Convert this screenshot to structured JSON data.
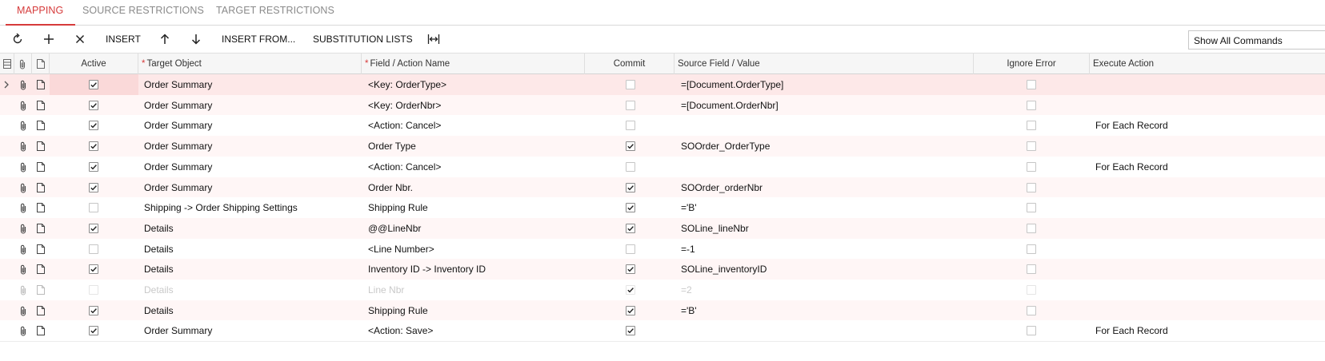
{
  "tabs": [
    {
      "label": "MAPPING",
      "active": true
    },
    {
      "label": "SOURCE RESTRICTIONS",
      "active": false
    },
    {
      "label": "TARGET RESTRICTIONS",
      "active": false
    }
  ],
  "toolbar": {
    "refresh_icon": "refresh-icon",
    "add_icon": "plus-icon",
    "delete_icon": "close-icon",
    "insert_label": "INSERT",
    "move_up_icon": "arrow-up-icon",
    "move_down_icon": "arrow-down-icon",
    "insert_from_label": "INSERT FROM...",
    "substitution_lists_label": "SUBSTITUTION LISTS",
    "fit_columns_icon": "fit-width-icon",
    "commands_value": "Show All Commands"
  },
  "columns": {
    "active": "Active",
    "target_object": "Target Object",
    "field_action": "Field / Action Name",
    "commit": "Commit",
    "source_field": "Source Field / Value",
    "ignore_error": "Ignore Error",
    "execute_action": "Execute Action"
  },
  "colors": {
    "accent": "#d63b3b"
  },
  "rows": [
    {
      "active": true,
      "target": "Order Summary",
      "field": "<Key: OrderType>",
      "commit": false,
      "source": "=[Document.OrderType]",
      "ignore": false,
      "execute": "",
      "selected": true
    },
    {
      "active": true,
      "target": "Order Summary",
      "field": "<Key: OrderNbr>",
      "commit": false,
      "source": "=[Document.OrderNbr]",
      "ignore": false,
      "execute": ""
    },
    {
      "active": true,
      "target": "Order Summary",
      "field": "<Action: Cancel>",
      "commit": false,
      "source": "",
      "ignore": false,
      "execute": "For Each Record"
    },
    {
      "active": true,
      "target": "Order Summary",
      "field": "Order Type",
      "commit": true,
      "source": "SOOrder_OrderType",
      "ignore": false,
      "execute": ""
    },
    {
      "active": true,
      "target": "Order Summary",
      "field": "<Action: Cancel>",
      "commit": false,
      "source": "",
      "ignore": false,
      "execute": "For Each Record"
    },
    {
      "active": true,
      "target": "Order Summary",
      "field": "Order Nbr.",
      "commit": true,
      "source": "SOOrder_orderNbr",
      "ignore": false,
      "execute": ""
    },
    {
      "active": false,
      "target": "Shipping -> Order Shipping Settings",
      "field": "Shipping Rule",
      "commit": true,
      "source": "='B'",
      "ignore": false,
      "execute": ""
    },
    {
      "active": true,
      "target": "Details",
      "field": "@@LineNbr",
      "commit": true,
      "source": "SOLine_lineNbr",
      "ignore": false,
      "execute": ""
    },
    {
      "active": false,
      "target": "Details",
      "field": "<Line Number>",
      "commit": false,
      "source": "=-1",
      "ignore": false,
      "execute": ""
    },
    {
      "active": true,
      "target": "Details",
      "field": "Inventory ID -> Inventory ID",
      "commit": true,
      "source": "SOLine_inventoryID",
      "ignore": false,
      "execute": ""
    },
    {
      "active": false,
      "target": "Details",
      "field": "Line Nbr",
      "commit": true,
      "source": "=2",
      "ignore": false,
      "execute": "",
      "dim": true
    },
    {
      "active": true,
      "target": "Details",
      "field": "Shipping Rule",
      "commit": true,
      "source": "='B'",
      "ignore": false,
      "execute": ""
    },
    {
      "active": true,
      "target": "Order Summary",
      "field": "<Action: Save>",
      "commit": true,
      "source": "",
      "ignore": false,
      "execute": "For Each Record"
    }
  ]
}
